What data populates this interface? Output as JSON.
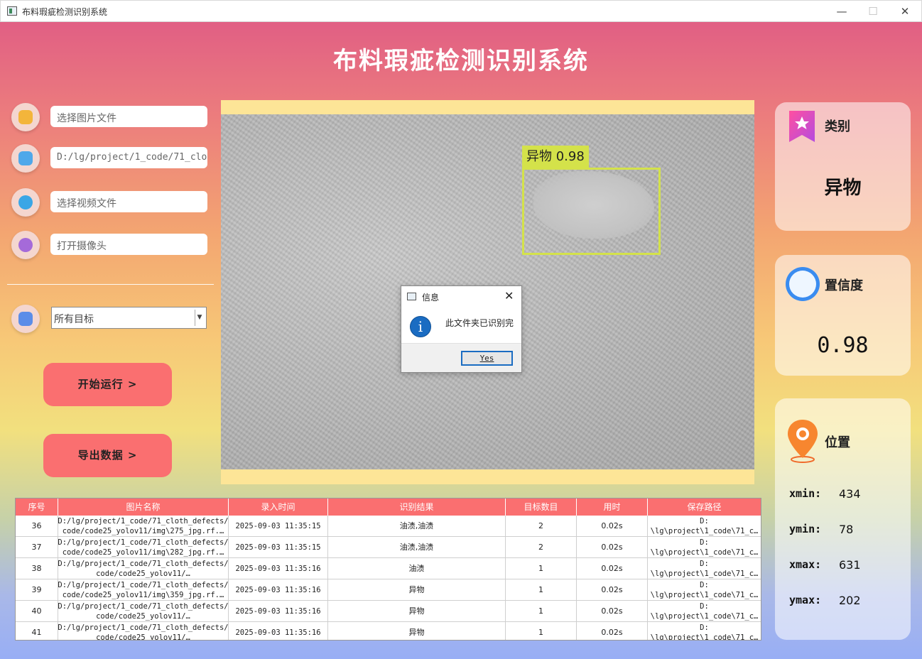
{
  "window": {
    "title": "布料瑕疵检测识别系统"
  },
  "header": {
    "title": "布料瑕疵检测识别系统"
  },
  "inputs": {
    "image_file": "选择图片文件",
    "folder_path": "D:/lg/project/1_code/71_clo",
    "video_file": "选择视频文件",
    "camera": "打开摄像头"
  },
  "target_select": {
    "selected": "所有目标"
  },
  "buttons": {
    "start": "开始运行 >",
    "export": "导出数据 >"
  },
  "detection": {
    "label": "异物 0.98",
    "color": "#d4e24a"
  },
  "result": {
    "class_label": "类别",
    "class_value": "异物",
    "confidence_label": "置信度",
    "confidence_value": "0.98",
    "position_label": "位置",
    "xmin_label": "xmin:",
    "xmin": "434",
    "ymin_label": "ymin:",
    "ymin": "78",
    "xmax_label": "xmax:",
    "xmax": "631",
    "ymax_label": "ymax:",
    "ymax": "202"
  },
  "table": {
    "headers": [
      "序号",
      "图片名称",
      "录入时间",
      "识别结果",
      "目标数目",
      "用时",
      "保存路径"
    ],
    "rows": [
      [
        "36",
        "D:/lg/project/1_code/71_cloth_defects/\ncode/code25_yolov11/img\\275_jpg.rf.…",
        "2025-09-03 11:35:15",
        "油渍,油渍",
        "2",
        "0.02s",
        "D:\n\\lg\\project\\1_code\\71_c…"
      ],
      [
        "37",
        "D:/lg/project/1_code/71_cloth_defects/\ncode/code25_yolov11/img\\282_jpg.rf.…",
        "2025-09-03 11:35:15",
        "油渍,油渍",
        "2",
        "0.02s",
        "D:\n\\lg\\project\\1_code\\71_c…"
      ],
      [
        "38",
        "D:/lg/project/1_code/71_cloth_defects/\ncode/code25_yolov11/…",
        "2025-09-03 11:35:16",
        "油渍",
        "1",
        "0.02s",
        "D:\n\\lg\\project\\1_code\\71_c…"
      ],
      [
        "39",
        "D:/lg/project/1_code/71_cloth_defects/\ncode/code25_yolov11/img\\359_jpg.rf.…",
        "2025-09-03 11:35:16",
        "异物",
        "1",
        "0.02s",
        "D:\n\\lg\\project\\1_code\\71_c…"
      ],
      [
        "40",
        "D:/lg/project/1_code/71_cloth_defects/\ncode/code25_yolov11/…",
        "2025-09-03 11:35:16",
        "异物",
        "1",
        "0.02s",
        "D:\n\\lg\\project\\1_code\\71_c…"
      ],
      [
        "41",
        "D:/lg/project/1_code/71_cloth_defects/\ncode/code25_yolov11/…",
        "2025-09-03 11:35:16",
        "异物",
        "1",
        "0.02s",
        "D:\n\\lg\\project\\1_code\\71_c…"
      ]
    ]
  },
  "dialog": {
    "title": "信息",
    "message": "此文件夹已识别完",
    "ok": "Yes"
  },
  "colors": {
    "accent": "#fa6f70",
    "display_frame": "#fde597",
    "info_icon": "#1a6cc2"
  }
}
